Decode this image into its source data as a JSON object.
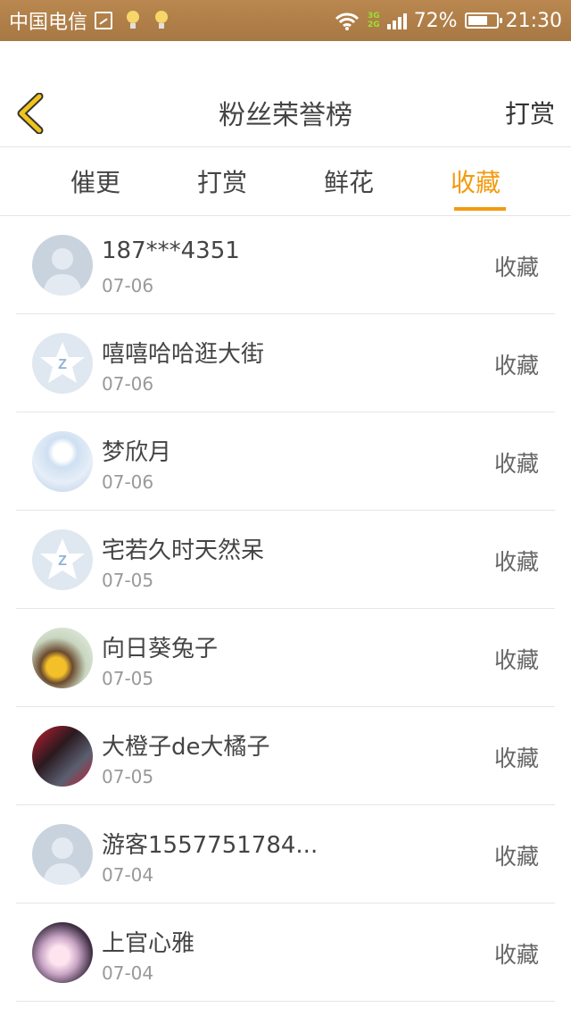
{
  "status_bar": {
    "carrier": "中国电信",
    "network_3g": "3G",
    "network_2g": "2G",
    "battery": "72%",
    "battery_level": 0.72,
    "time": "21:30"
  },
  "header": {
    "title": "粉丝荣誉榜",
    "right_action": "打赏",
    "back_icon": "chevron-left-icon",
    "back_color": "#f0c419"
  },
  "tabs": [
    {
      "label": "催更"
    },
    {
      "label": "打赏"
    },
    {
      "label": "鲜花"
    },
    {
      "label": "收藏",
      "active": true
    }
  ],
  "accent_color": "#f29b0e",
  "fans": [
    {
      "name": "187***4351",
      "date": "07-06",
      "action": "收藏",
      "avatar": "default-avatar"
    },
    {
      "name": "嘻嘻哈哈逛大街",
      "date": "07-06",
      "action": "收藏",
      "avatar": "qq-star-avatar"
    },
    {
      "name": "梦欣月",
      "date": "07-06",
      "action": "收藏",
      "avatar": "anime-avatar"
    },
    {
      "name": "宅若久时天然呆",
      "date": "07-05",
      "action": "收藏",
      "avatar": "qq-star-avatar"
    },
    {
      "name": "向日葵兔子",
      "date": "07-05",
      "action": "收藏",
      "avatar": "sunflower-avatar"
    },
    {
      "name": "大橙子de大橘子",
      "date": "07-05",
      "action": "收藏",
      "avatar": "group-photo-avatar"
    },
    {
      "name": "游客1557751784...",
      "date": "07-04",
      "action": "收藏",
      "avatar": "default-avatar"
    },
    {
      "name": "上官心雅",
      "date": "07-04",
      "action": "收藏",
      "avatar": "blossom-avatar"
    }
  ]
}
